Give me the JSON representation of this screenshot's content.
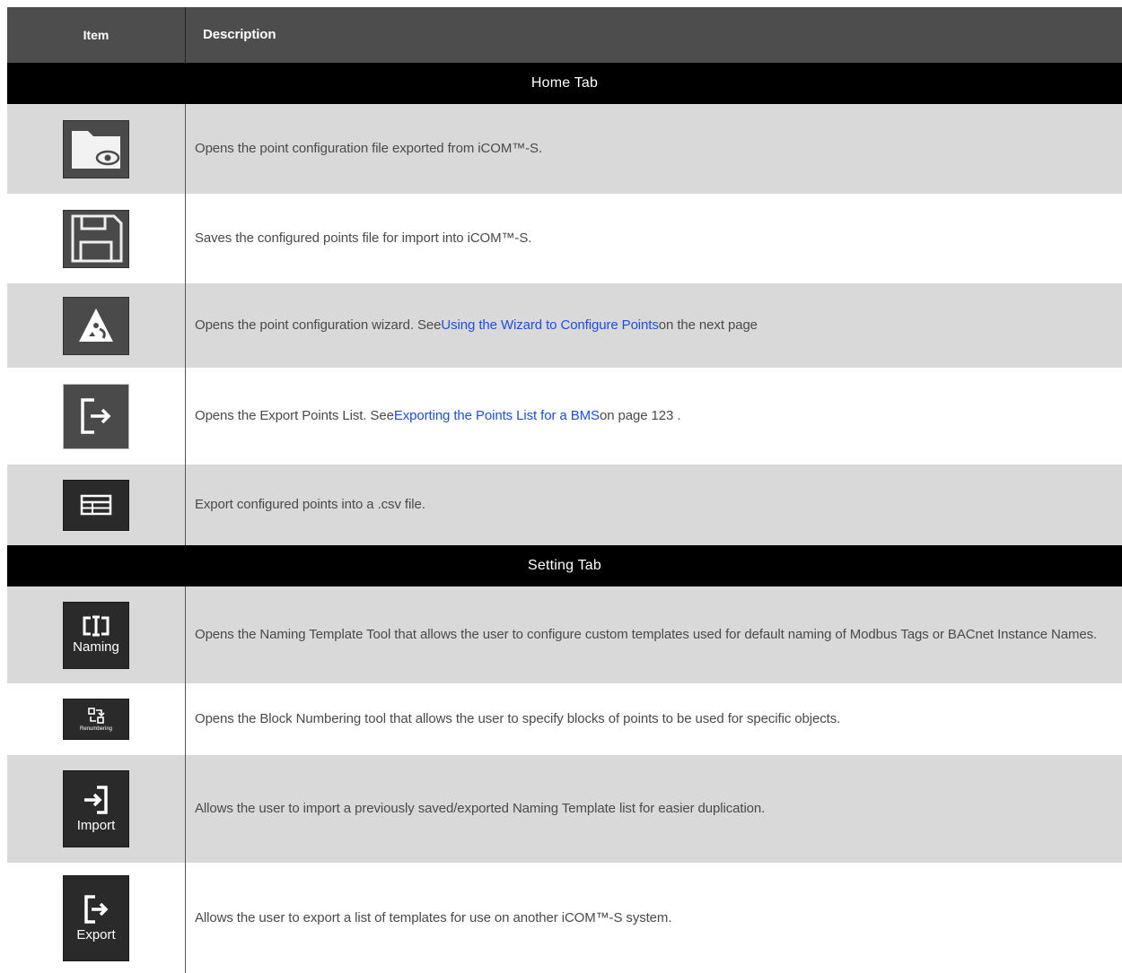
{
  "header": {
    "item": "Item",
    "description": "Description"
  },
  "sections": {
    "home": "Home Tab",
    "setting": "Setting Tab"
  },
  "home_rows": [
    {
      "icon": "folder-eye-icon",
      "text": "Opens the point configuration file exported from iCOM™-S."
    },
    {
      "icon": "floppy-disk-icon",
      "text": "Saves the configured points file for import into iCOM™-S."
    },
    {
      "icon": "wizard-icon",
      "pre": "Opens the point configuration wizard. See ",
      "link": "Using the Wizard to Configure Points",
      "post": " on the next page"
    },
    {
      "icon": "export-arrow-icon",
      "pre": "Opens the Export Points List. See ",
      "link": "Exporting the Points List for a BMS",
      "post": " on page 123 ."
    },
    {
      "icon": "csv-table-icon",
      "text": "Export configured points into a .csv file."
    }
  ],
  "setting_rows": [
    {
      "icon": "naming-icon",
      "icon_label": "Naming",
      "text": "Opens the Naming Template Tool that allows the user to configure custom templates used for default naming of Modbus Tags or BACnet Instance Names."
    },
    {
      "icon": "renumbering-icon",
      "icon_label": "Renumbering",
      "text": "Opens the Block Numbering tool that allows the user to specify blocks of points to be used for specific objects."
    },
    {
      "icon": "import-icon",
      "icon_label": "Import",
      "text": "Allows the user to import a previously saved/exported Naming Template list for easier duplication."
    },
    {
      "icon": "export-icon",
      "icon_label": "Export",
      "text": "Allows the user to export a list of templates for use on another iCOM™-S system."
    }
  ]
}
